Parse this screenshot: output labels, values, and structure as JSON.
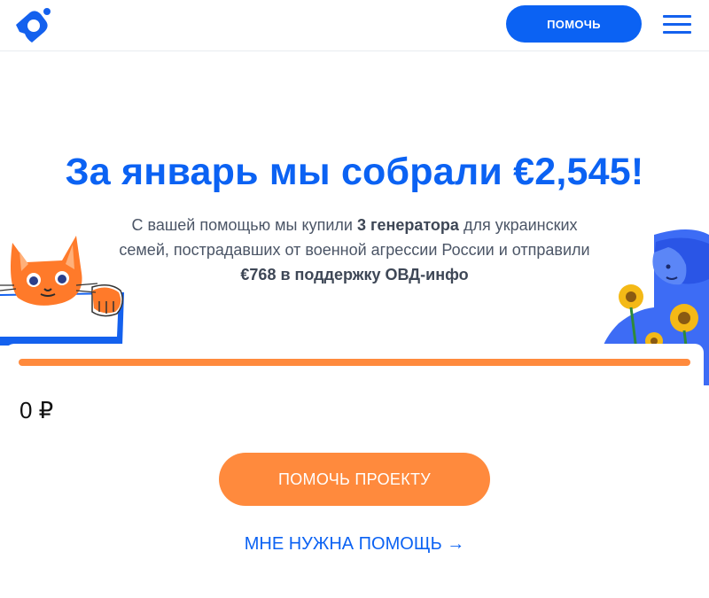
{
  "header": {
    "help_label": "ПОМОЧЬ",
    "logo_icon": "logo-icon",
    "menu_icon": "hamburger-menu-icon"
  },
  "hero": {
    "headline": "За январь мы собрали €2,545!",
    "sub_1": "С вашей помощью мы купили ",
    "sub_bold_1": "3 генератора",
    "sub_2": " для украинских семей, пострадавших от военной агрессии России и отправили ",
    "sub_bold_2": "€768 в поддержку ОВД-инфо"
  },
  "progress": {
    "amount": "0 ₽",
    "fill_fraction": 1.0
  },
  "actions": {
    "cta_label": "ПОМОЧЬ ПРОЕКТУ",
    "need_help_label": "МНЕ НУЖНА ПОМОЩЬ",
    "need_help_arrow": "→"
  },
  "colors": {
    "brand_blue": "#0b62f3",
    "accent_orange": "#ff8a3d"
  }
}
